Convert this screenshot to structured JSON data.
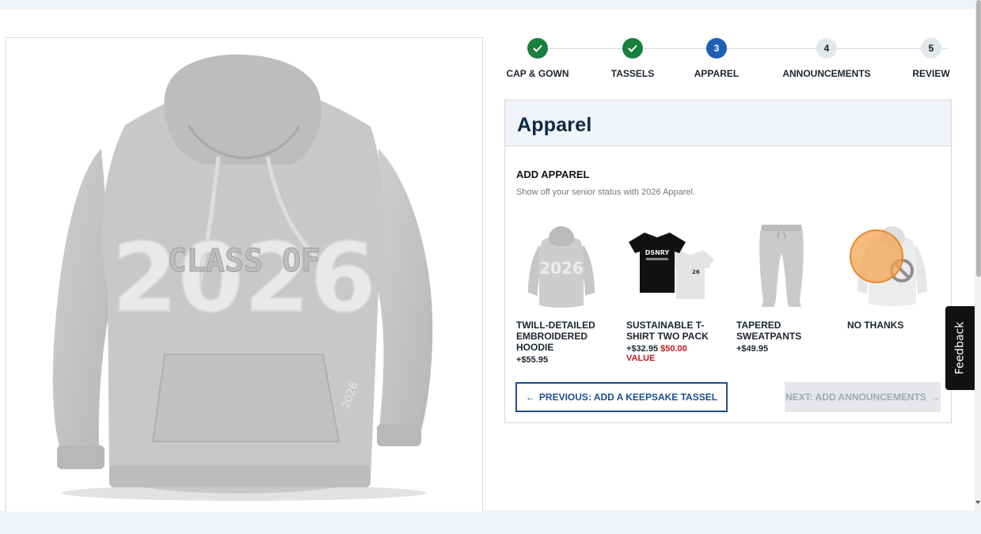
{
  "stepper": {
    "steps": [
      {
        "label": "CAP & GOWN",
        "state": "done",
        "number": "1"
      },
      {
        "label": "TASSELS",
        "state": "done",
        "number": "2"
      },
      {
        "label": "APPAREL",
        "state": "current",
        "number": "3"
      },
      {
        "label": "ANNOUNCEMENTS",
        "state": "todo",
        "number": "4"
      },
      {
        "label": "REVIEW",
        "state": "todo",
        "number": "5"
      }
    ]
  },
  "card": {
    "title": "Apparel",
    "section_title": "ADD APPAREL",
    "section_subtitle": "Show off your senior status with 2026 Apparel.",
    "options": [
      {
        "name": "TWILL-DETAILED EMBROIDERED HOODIE",
        "price": "+$55.95",
        "image": "hoodie-image"
      },
      {
        "name": "SUSTAINABLE T-SHIRT TWO PACK",
        "price": "+$32.95",
        "strike_price": "$50.00",
        "value_label": "VALUE",
        "image": "tshirt-two-pack-image"
      },
      {
        "name": "TAPERED SWEATPANTS",
        "price": "+$49.95",
        "image": "sweatpants-image"
      },
      {
        "name": "NO THANKS",
        "price": "",
        "image": "no-thanks-image"
      }
    ],
    "prev_button": "PREVIOUS: ADD A KEEPSAKE TASSEL",
    "next_button": "NEXT: ADD ANNOUNCEMENTS",
    "prev_arrow": "←",
    "next_arrow": "→"
  },
  "hero_image": {
    "print_top": "2026",
    "print_middle": "CLASS OF",
    "sleeve_print": "2026"
  },
  "feedback_tab": {
    "label": "Feedback"
  },
  "colors": {
    "step_done": "#17803d",
    "step_current": "#1c5fb8",
    "title": "#0e2a47",
    "price_highlight": "#c0191f",
    "primary_button_border": "#1c4f8f"
  }
}
